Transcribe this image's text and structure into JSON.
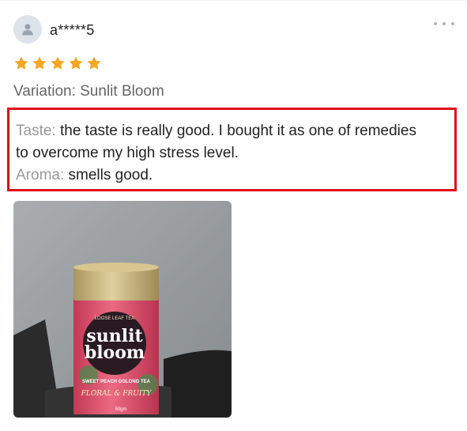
{
  "review": {
    "username": "a*****5",
    "rating": 5,
    "variation": "Variation: Sunlit Bloom",
    "taste_label": "Taste:",
    "taste_text_line1": "the taste is really good. I bought it as one of remedies",
    "taste_text_line2": "to overcome my high stress level.",
    "aroma_label": "Aroma:",
    "aroma_text": "smells good."
  },
  "product_photo": {
    "brand_line1": "sunlit",
    "brand_line2": "bloom",
    "small_top": "LOOSE LEAF TEA",
    "tagline": "SWEET PEACH OOLONG TEA",
    "script": "FLORAL & FRUITY",
    "weight": "50gm"
  },
  "colors": {
    "star": "#f5a623",
    "highlight_border": "#e0101a",
    "can_lid": "#c8b37a",
    "can_body": "#e0506a",
    "wall": "#9ea3a6"
  },
  "icons": {
    "avatar": "person-icon",
    "menu": "more-horizontal-icon",
    "rating": "star-icon"
  }
}
